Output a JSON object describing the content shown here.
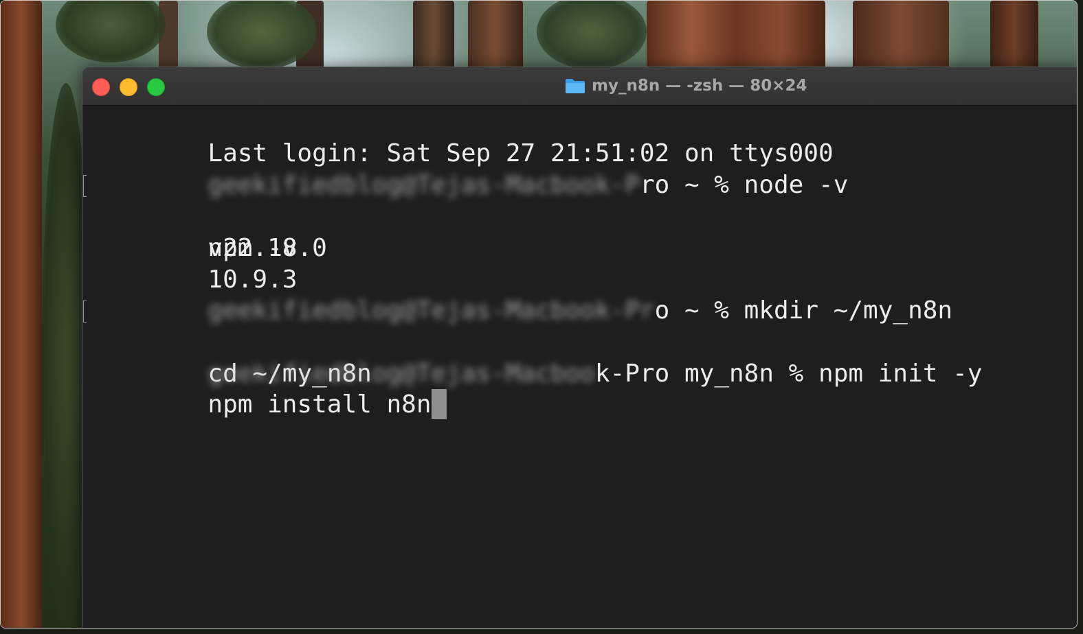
{
  "window": {
    "title": "my_n8n — -zsh — 80×24",
    "folder_icon": "folder-icon",
    "traffic_lights": {
      "close": "#ff5f57",
      "minimize": "#febc2e",
      "maximize": "#28c840"
    }
  },
  "terminal": {
    "lines": [
      {
        "text": "Last login: Sat Sep 27 21:51:02 on ttys000"
      },
      {
        "hidden_prefix": "geekifiedblog@Tejas-Macbook-P",
        "text": "ro ~ % node -v"
      },
      {
        "text": "npm -v"
      },
      {
        "text": "v22.18.0"
      },
      {
        "text": "10.9.3"
      },
      {
        "hidden_prefix": "geekifiedblog@Tejas-Macbook-Pr",
        "text": "o ~ % mkdir ~/my_n8n"
      },
      {
        "text": "cd ~/my_n8n"
      },
      {
        "hidden_prefix": "geekifiedblog@Tejas-Macboo",
        "text": "k-Pro my_n8n % npm init -y"
      },
      {
        "text": "npm install n8n"
      }
    ]
  }
}
